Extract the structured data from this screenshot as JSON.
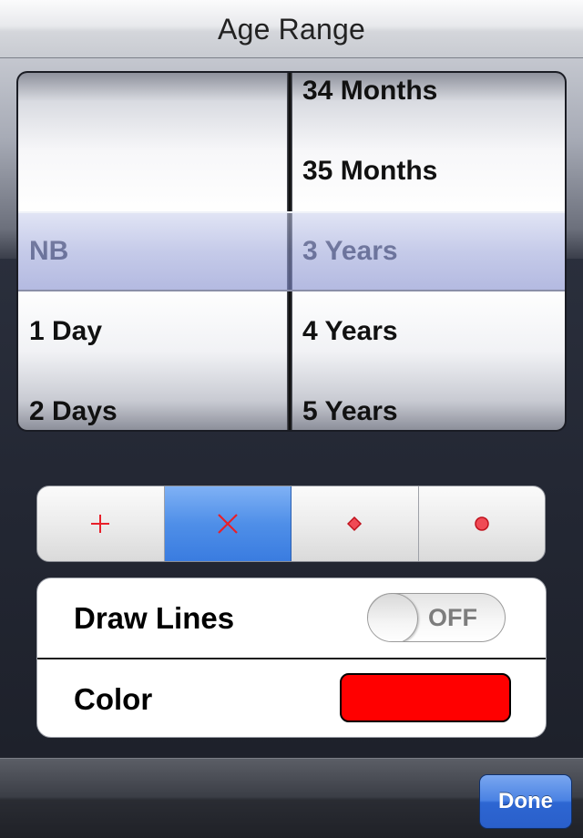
{
  "header": {
    "title": "Age Range"
  },
  "picker": {
    "left_column": [
      "",
      "",
      "NB",
      "1 Day",
      "2 Days"
    ],
    "right_column": [
      "34 Months",
      "35 Months",
      "3 Years",
      "4 Years",
      "5 Years"
    ],
    "selected": {
      "left": "NB",
      "right": "3 Years"
    }
  },
  "marker_style": {
    "options": [
      {
        "icon": "plus-icon"
      },
      {
        "icon": "cross-icon",
        "selected": true
      },
      {
        "icon": "diamond-icon"
      },
      {
        "icon": "circle-icon"
      }
    ],
    "icon_color": "#e8202a"
  },
  "settings": {
    "draw_lines": {
      "label": "Draw Lines",
      "state": "OFF"
    },
    "color": {
      "label": "Color",
      "value": "#ff0000"
    }
  },
  "toolbar": {
    "done_label": "Done"
  }
}
